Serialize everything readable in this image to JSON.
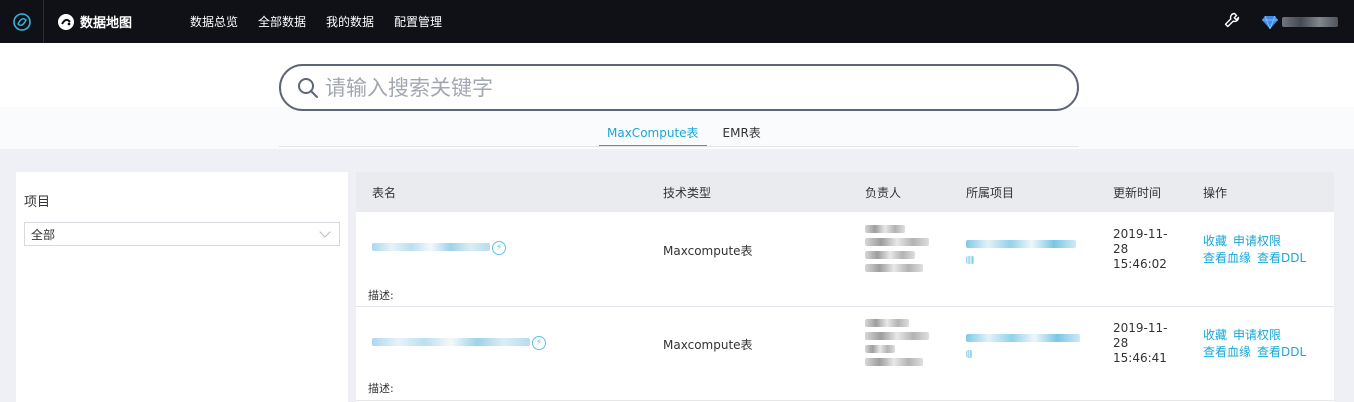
{
  "header": {
    "app_title": "数据地图",
    "nav": [
      "数据总览",
      "全部数据",
      "我的数据",
      "配置管理"
    ],
    "logo_icon": "swirl-logo-icon",
    "tools_icon": "wrench-icon",
    "user_icon": "diamond-user-icon"
  },
  "search": {
    "placeholder": "请输入搜索关键字",
    "value": ""
  },
  "tabs": [
    {
      "label": "MaxCompute表",
      "active": true
    },
    {
      "label": "EMR表",
      "active": false
    }
  ],
  "filter": {
    "title": "项目",
    "selected": "全部"
  },
  "table": {
    "headers": [
      "表名",
      "技术类型",
      "负责人",
      "所属项目",
      "更新时间",
      "操作"
    ],
    "rows": [
      {
        "tech_type": "Maxcompute表",
        "update_date": "2019-11-28",
        "update_time": "15:46:02",
        "description_label": "描述:",
        "actions": [
          "收藏",
          "申请权限",
          "查看血缘",
          "查看DDL"
        ]
      },
      {
        "tech_type": "Maxcompute表",
        "update_date": "2019-11-28",
        "update_time": "15:46:41",
        "description_label": "描述:",
        "actions": [
          "收藏",
          "申请权限",
          "查看血缘",
          "查看DDL"
        ]
      }
    ]
  },
  "colors": {
    "accent": "#1aa7d6",
    "topbar": "#0f1117",
    "page_bg": "#eef0f5"
  }
}
